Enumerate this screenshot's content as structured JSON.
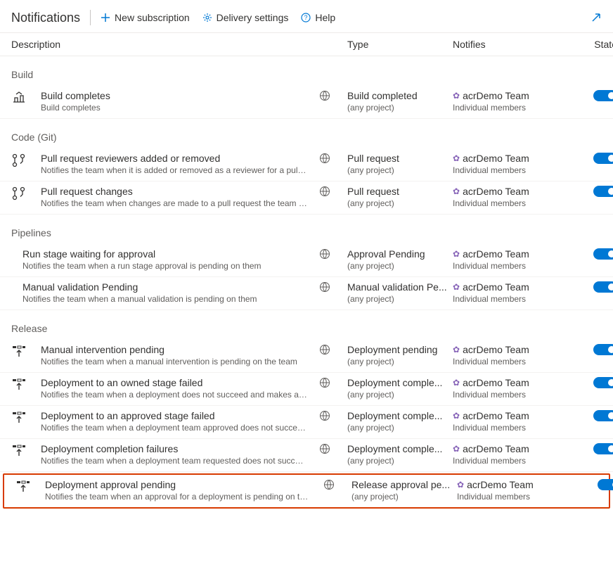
{
  "header": {
    "title": "Notifications",
    "new_subscription": "New subscription",
    "delivery_settings": "Delivery settings",
    "help": "Help"
  },
  "columns": {
    "description": "Description",
    "type": "Type",
    "notifies": "Notifies",
    "state": "State"
  },
  "common": {
    "any_project": "(any project)",
    "team": "acrDemo Team",
    "members": "Individual members"
  },
  "sections": {
    "build": "Build",
    "code": "Code (Git)",
    "pipelines": "Pipelines",
    "release": "Release"
  },
  "rows": {
    "build_completes": {
      "title": "Build completes",
      "sub": "Build completes",
      "type": "Build completed"
    },
    "pr_reviewers": {
      "title": "Pull request reviewers added or removed",
      "sub": "Notifies the team when it is added or removed as a reviewer for a pull requ...",
      "type": "Pull request"
    },
    "pr_changes": {
      "title": "Pull request changes",
      "sub": "Notifies the team when changes are made to a pull request the team is a r...",
      "type": "Pull request"
    },
    "run_stage": {
      "title": "Run stage waiting for approval",
      "sub": "Notifies the team when a run stage approval is pending on them",
      "type": "Approval Pending"
    },
    "manual_validation": {
      "title": "Manual validation Pending",
      "sub": "Notifies the team when a manual validation is pending on them",
      "type": "Manual validation Pe..."
    },
    "manual_intervention": {
      "title": "Manual intervention pending",
      "sub": "Notifies the team when a manual intervention is pending on the team",
      "type": "Deployment pending"
    },
    "deploy_owned_failed": {
      "title": "Deployment to an owned stage failed",
      "sub": "Notifies the team when a deployment does not succeed and makes a stag...",
      "type": "Deployment comple..."
    },
    "deploy_approved_failed": {
      "title": "Deployment to an approved stage failed",
      "sub": "Notifies the team when a deployment team approved does not succeed an...",
      "type": "Deployment comple..."
    },
    "deploy_completion_fail": {
      "title": "Deployment completion failures",
      "sub": "Notifies the team when a deployment team requested does not succeed a...",
      "type": "Deployment comple..."
    },
    "deploy_approval_pending": {
      "title": "Deployment approval pending",
      "sub": "Notifies the team when an approval for a deployment is pending on the te...",
      "type": "Release approval pe..."
    }
  }
}
